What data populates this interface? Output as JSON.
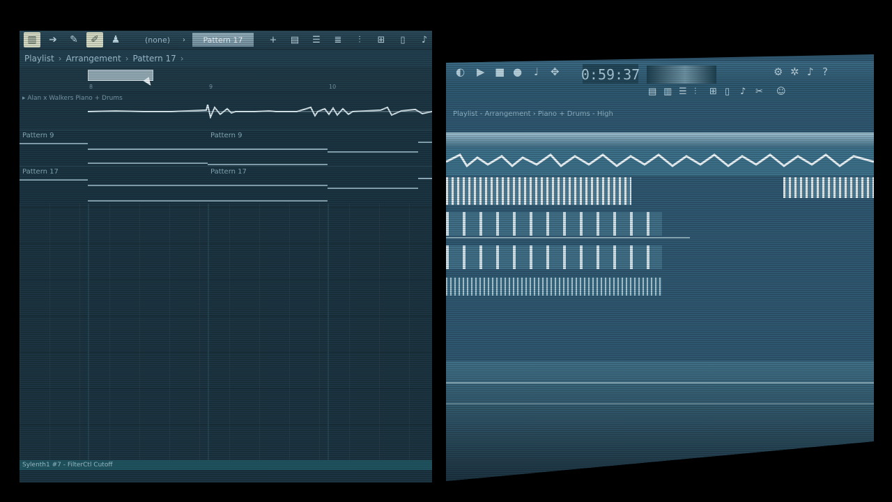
{
  "left_panel": {
    "toolbar": {
      "none_label": "(none)",
      "pattern_select": "Pattern 17"
    },
    "breadcrumb": {
      "items": [
        "Playlist",
        "Arrangement",
        "Pattern 17"
      ],
      "separator": "›"
    },
    "timeline": {
      "ticks": [
        "8",
        "9",
        "10"
      ]
    },
    "audio_track": {
      "label": "▸ Alan x Walkers Piano + Drums"
    },
    "pattern_tracks": [
      {
        "label": "Pattern 9",
        "clip_label": "Pattern 9"
      },
      {
        "label": "Pattern 17",
        "clip_label": "Pattern 17"
      }
    ],
    "automation_clip": {
      "label": "Sylenth1 #7 - FilterCtl Cutoff"
    }
  },
  "right_panel": {
    "time_display": "0:59:37",
    "title": "Playlist - Arrangement › Piano + Drums - High"
  },
  "colors": {
    "panel_bg": "#1c3441",
    "accent": "#a6c6d3",
    "automation": "#1f5460"
  }
}
